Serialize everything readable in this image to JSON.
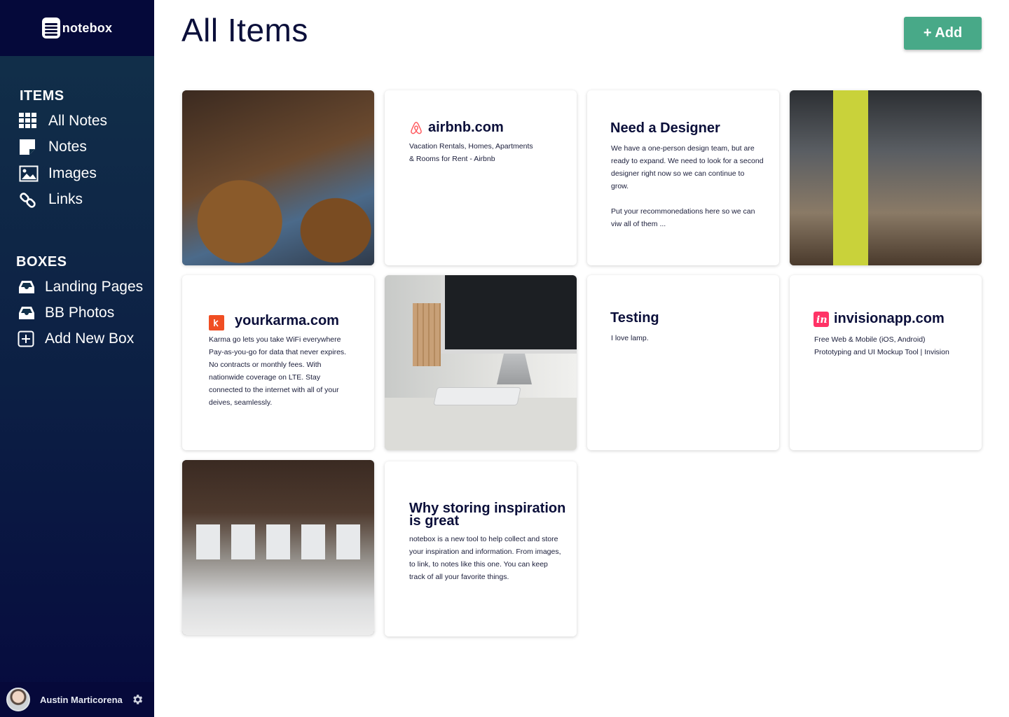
{
  "app": {
    "brand": "notebox"
  },
  "sidebar": {
    "items_title": "ITEMS",
    "items": [
      {
        "label": "All Notes",
        "icon": "grid-icon"
      },
      {
        "label": "Notes",
        "icon": "note-icon"
      },
      {
        "label": "Images",
        "icon": "image-icon"
      },
      {
        "label": "Links",
        "icon": "link-icon"
      }
    ],
    "boxes_title": "BOXES",
    "boxes": [
      {
        "label": "Landing Pages",
        "icon": "inbox-icon"
      },
      {
        "label": "BB Photos",
        "icon": "inbox-icon"
      },
      {
        "label": "Add New Box",
        "icon": "plus-square-icon"
      }
    ]
  },
  "user": {
    "name": "Austin Marticorena"
  },
  "header": {
    "title": "All Items",
    "add_label": "+ Add"
  },
  "cards": [
    {
      "type": "image",
      "alt": "bar-photo"
    },
    {
      "type": "link",
      "title": "airbnb.com",
      "icon": "airbnb-icon",
      "body": "Vacation Rentals, Homes, Apartments\n& Rooms for Rent - Airbnb",
      "accent": "#ff5a5f"
    },
    {
      "type": "note",
      "title": "Need a Designer",
      "body": "We have a one-person design team, but are\nready to expand. We need to look for a second\ndesigner right now so we can continue to\ngrow.\n\nPut your recommonedations here so we can\nviw all of them ..."
    },
    {
      "type": "image",
      "alt": "office-photo"
    },
    {
      "type": "link",
      "title": "yourkarma.com",
      "icon": "karma-icon",
      "body": "Karma go lets you take WiFi everywhere\nPay-as-you-go for data that never expires.\nNo contracts or monthly fees. With\nnationwide coverage on LTE. Stay\nconnected to the internet with all of your\ndeives, seamlessly.",
      "accent": "#f04e23"
    },
    {
      "type": "image",
      "alt": "desk-photo"
    },
    {
      "type": "note",
      "title": "Testing",
      "body": "I love lamp."
    },
    {
      "type": "link",
      "title": "invisionapp.com",
      "icon": "invision-icon",
      "body": "Free Web & Mobile (iOS, Android)\nPrototyping and UI Mockup Tool | Invision",
      "accent": "#ff3366"
    },
    {
      "type": "image",
      "alt": "office-loft-photo"
    },
    {
      "type": "note",
      "title": "Why storing inspiration\nis great",
      "body": "notebox is a new tool to help collect and store\nyour inspiration and information. From images,\nto link, to notes like this one. You can keep\ntrack of all your favorite things."
    }
  ]
}
